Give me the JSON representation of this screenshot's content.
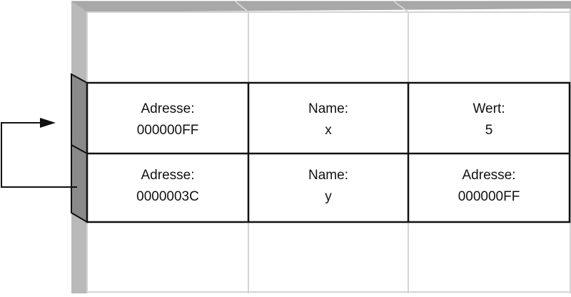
{
  "rows": [
    {
      "cells": [
        {
          "label": "Adresse:",
          "value": "000000FF"
        },
        {
          "label": "Name:",
          "value": "x"
        },
        {
          "label": "Wert:",
          "value": "5"
        }
      ]
    },
    {
      "cells": [
        {
          "label": "Adresse:",
          "value": "0000003C"
        },
        {
          "label": "Name:",
          "value": "y"
        },
        {
          "label": "Adresse:",
          "value": "000000FF"
        }
      ]
    }
  ],
  "colors": {
    "grid_light": "#d4d4d4",
    "grid_dark": "#111111",
    "side_light": "#b9b9b9",
    "side_dark": "#8a8a8a",
    "top_face": "#a8a8a8"
  }
}
